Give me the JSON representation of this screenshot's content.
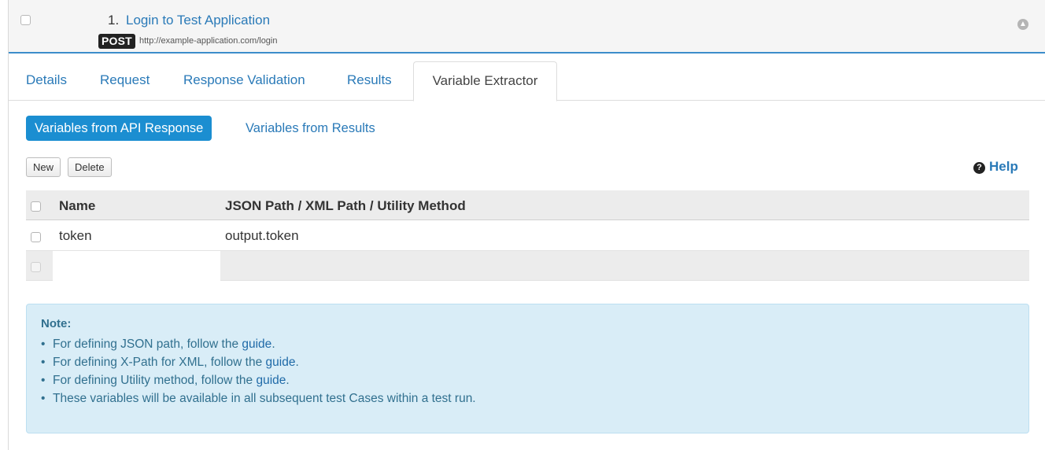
{
  "header": {
    "number": "1.",
    "title": "Login to Test Application",
    "method": "POST",
    "url": "http://example-application.com/login"
  },
  "tabs": {
    "details": "Details",
    "request": "Request",
    "response_validation": "Response Validation",
    "results": "Results",
    "variable_extractor": "Variable Extractor"
  },
  "subtabs": {
    "api_response": "Variables from API Response",
    "results": "Variables from Results"
  },
  "toolbar": {
    "new_label": "New",
    "delete_label": "Delete",
    "help_label": "Help"
  },
  "table": {
    "headers": [
      "Name",
      "JSON Path / XML Path / Utility Method"
    ],
    "rows": [
      {
        "name": "token",
        "path": "output.token"
      }
    ]
  },
  "note": {
    "title": "Note:",
    "items": [
      {
        "text": "For defining JSON path, follow the ",
        "link": "guide",
        "suffix": "."
      },
      {
        "text": "For defining X-Path for XML, follow the ",
        "link": "guide",
        "suffix": "."
      },
      {
        "text": "For defining Utility method, follow the ",
        "link": "guide",
        "suffix": "."
      },
      {
        "text": "These variables will be available in all subsequent test Cases within a test run.",
        "link": "",
        "suffix": ""
      }
    ]
  },
  "colors": {
    "accent": "#1b8ed1",
    "link": "#2a7ab8",
    "note_bg": "#d9edf7",
    "note_text": "#31708f"
  }
}
